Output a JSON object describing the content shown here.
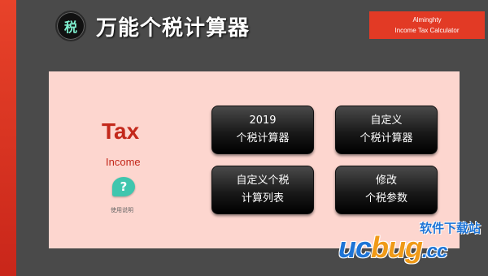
{
  "header": {
    "logo_char": "税",
    "title": "万能个税计算器",
    "brand_line1": "Alminghty",
    "brand_line2": "Income Tax Calculator"
  },
  "panel": {
    "tax_title": "Tax",
    "tax_subtitle": "Income",
    "help_icon_char": "?",
    "help_label": "使用说明",
    "buttons": [
      {
        "line1": "2019",
        "line2": "个税计算器"
      },
      {
        "line1": "自定义",
        "line2": "个税计算器"
      },
      {
        "line1": "自定义个税",
        "line2": "计算列表"
      },
      {
        "line1": "修改",
        "line2": "个税参数"
      }
    ]
  },
  "watermark": {
    "top_text": "软件下载站",
    "uc": "uc",
    "bug": "bug",
    "cc": ".cc"
  },
  "colors": {
    "accent_red": "#e23a25",
    "panel_bg": "#fdd6cf",
    "help_teal": "#3fc6ae",
    "title_red": "#c3281b"
  }
}
